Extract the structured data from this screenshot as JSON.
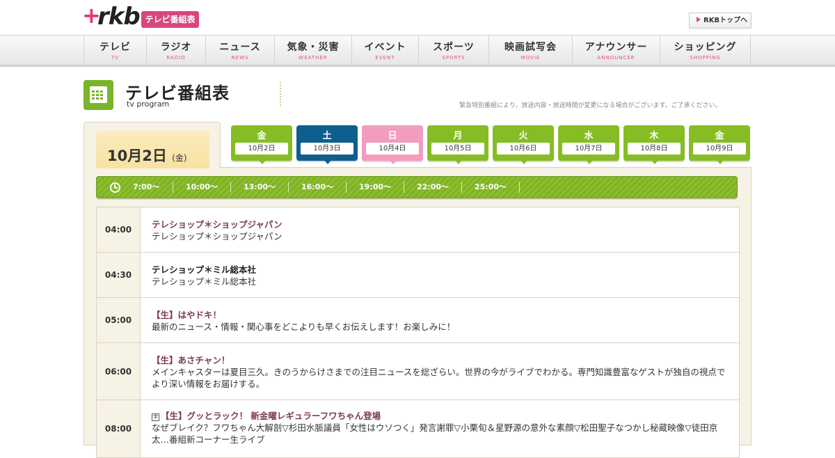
{
  "header": {
    "logo_plus": "+",
    "logo_text": "rkb",
    "badge": "テレビ番組表",
    "top_link": "RKBトップへ"
  },
  "nav": [
    {
      "jp": "テレビ",
      "en": "TV"
    },
    {
      "jp": "ラジオ",
      "en": "RADIO"
    },
    {
      "jp": "ニュース",
      "en": "NEWS"
    },
    {
      "jp": "気象・災害",
      "en": "WEATHER"
    },
    {
      "jp": "イベント",
      "en": "EVENT"
    },
    {
      "jp": "スポーツ",
      "en": "SPORTS"
    },
    {
      "jp": "映画試写会",
      "en": "MOVIE"
    },
    {
      "jp": "アナウンサー",
      "en": "ANNOUNCER"
    },
    {
      "jp": "ショッピング",
      "en": "SHOPPING"
    }
  ],
  "page": {
    "title": "テレビ番組表",
    "subtitle": "tv program",
    "notice": "緊急特別番組により、放送内容・放送時間が変更になる場合がございます。ご了承ください。"
  },
  "current": {
    "date": "10月2日",
    "dow": "(金)"
  },
  "days": [
    {
      "dow": "金",
      "date": "10月2日",
      "color": "#86bd24"
    },
    {
      "dow": "土",
      "date": "10月3日",
      "color": "#0e5f8e"
    },
    {
      "dow": "日",
      "date": "10月4日",
      "color": "#f29cbf"
    },
    {
      "dow": "月",
      "date": "10月5日",
      "color": "#86bd24"
    },
    {
      "dow": "火",
      "date": "10月6日",
      "color": "#86bd24"
    },
    {
      "dow": "水",
      "date": "10月7日",
      "color": "#86bd24"
    },
    {
      "dow": "木",
      "date": "10月8日",
      "color": "#86bd24"
    },
    {
      "dow": "金",
      "date": "10月9日",
      "color": "#86bd24"
    }
  ],
  "times": [
    "7:00～",
    "10:00～",
    "13:00～",
    "16:00～",
    "19:00～",
    "22:00～",
    "25:00～"
  ],
  "programs": [
    {
      "time": "04:00",
      "title": "テレショップ＊ショップジャパン",
      "desc": "テレショップ＊ショップジャパン"
    },
    {
      "time": "04:30",
      "title": "テレショップ＊ミル総本社",
      "desc": "テレショップ＊ミル総本社"
    },
    {
      "time": "05:00",
      "title": "【生】はやドキ！",
      "desc": "最新のニュース・情報・関心事をどこよりも早くお伝えします！お楽しみに！"
    },
    {
      "time": "06:00",
      "title": "【生】あさチャン！",
      "desc": "メインキャスターは夏目三久。きのうからけさまでの注目ニュースを総ざらい。世界の今がライブでわかる。専門知識豊富なゲストが独自の視点でより深い情報をお届けする。"
    },
    {
      "time": "08:00",
      "mark": "字",
      "title": "【生】グッとラック！ 新金曜レギュラーフワちゃん登場",
      "desc": "なぜブレイク？フワちゃん大解剖▽杉田水脈議員「女性はウソつく」発言謝罪▽小栗旬＆星野源の意外な素顔▽松田聖子なつかし秘蔵映像▽徒田京太…番組新コーナー生ライブ"
    }
  ]
}
